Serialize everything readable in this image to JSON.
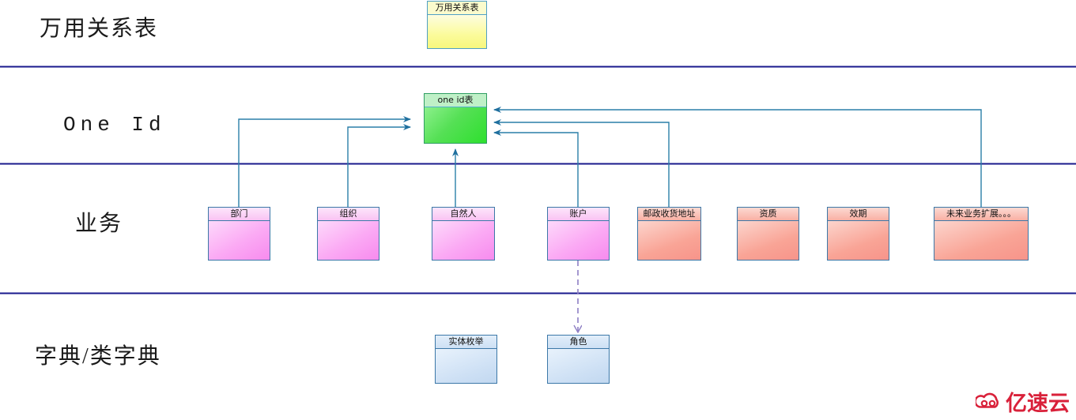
{
  "diagram": {
    "title_band_labels": [
      {
        "text": "万用关系表"
      },
      {
        "text": "One Id"
      },
      {
        "text": "业务"
      },
      {
        "text": "字典/类字典"
      }
    ],
    "nodes": {
      "universal_relation": {
        "label": "万用关系表",
        "color": "#f7f77d"
      },
      "one_id": {
        "label": "one id表",
        "color": "#2ee02e"
      },
      "department": {
        "label": "部门",
        "color": "#f78bee"
      },
      "organization": {
        "label": "组织",
        "color": "#f78bee"
      },
      "natural_person": {
        "label": "自然人",
        "color": "#f78bee"
      },
      "account": {
        "label": "账户",
        "color": "#f78bee"
      },
      "postal_address": {
        "label": "邮政收货地址",
        "color": "#f7948a"
      },
      "qualification": {
        "label": "资质",
        "color": "#f7948a"
      },
      "validity_period": {
        "label": "效期",
        "color": "#f7948a"
      },
      "future_business": {
        "label": "未来业务扩展。。。",
        "color": "#f7948a"
      },
      "entity_enum": {
        "label": "实体枚举",
        "color": "#c2d8f0"
      },
      "role": {
        "label": "角色",
        "color": "#c2d8f0"
      }
    },
    "connections": [
      {
        "from": "部门",
        "to": "one id表",
        "style": "solid",
        "color": "#2a7fa8"
      },
      {
        "from": "组织",
        "to": "one id表",
        "style": "solid",
        "color": "#2a7fa8"
      },
      {
        "from": "自然人",
        "to": "one id表",
        "style": "solid",
        "color": "#2a7fa8"
      },
      {
        "from": "账户",
        "to": "one id表",
        "style": "solid",
        "color": "#2a7fa8"
      },
      {
        "from": "邮政收货地址",
        "to": "one id表",
        "style": "solid",
        "color": "#2a7fa8"
      },
      {
        "from": "未来业务扩展。。。",
        "to": "one id表",
        "style": "solid",
        "color": "#2a7fa8"
      },
      {
        "from": "账户",
        "to": "角色",
        "style": "dashed",
        "color": "#8e7fc4"
      }
    ],
    "divider_color": "#1a1a8c",
    "watermark": {
      "text": "亿速云",
      "color": "#d9213a",
      "icon": "cloud-logo-icon"
    }
  }
}
